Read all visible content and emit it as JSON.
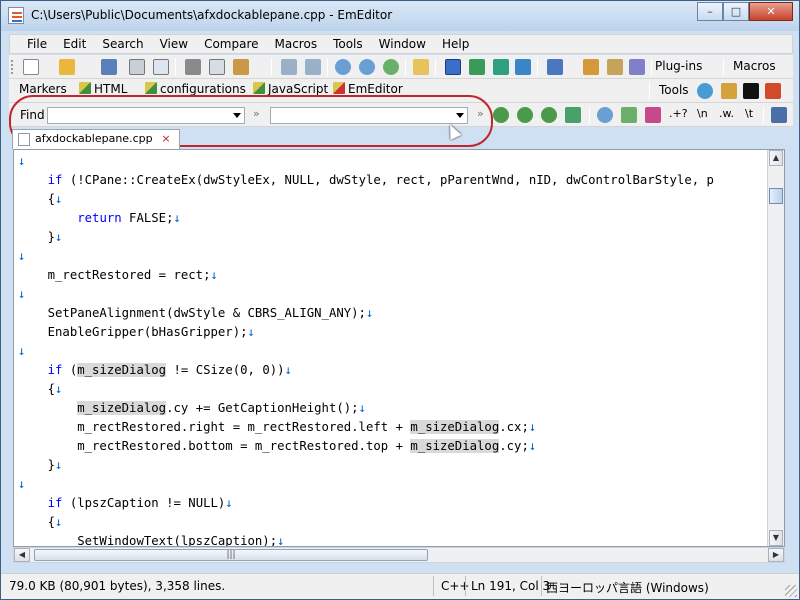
{
  "window": {
    "title": "C:\\Users\\Public\\Documents\\afxdockablepane.cpp - EmEditor",
    "minimize": "–",
    "maximize": "□",
    "close": "✕"
  },
  "menu": [
    "File",
    "Edit",
    "Search",
    "View",
    "Compare",
    "Macros",
    "Tools",
    "Window",
    "Help"
  ],
  "toolbar": {
    "plugins_label": "Plug-ins",
    "macros_label": "Macros",
    "tools_label": "Tools"
  },
  "markers": {
    "label": "Markers",
    "items": [
      "HTML",
      "configurations",
      "JavaScript",
      "EmEditor"
    ]
  },
  "find_bar": {
    "label": "Find",
    "find_value": "",
    "replace_value": "",
    "chevron": "»",
    "buttons": [
      ".+?",
      "\\n",
      ".w.",
      "\\t"
    ]
  },
  "tab": {
    "name": "afxdockablepane.cpp",
    "close": "×"
  },
  "code": {
    "lines": [
      [
        {
          "t": "↓",
          "c": "eol"
        }
      ],
      [
        {
          "t": "    "
        },
        {
          "t": "if",
          "c": "kw"
        },
        {
          "t": " (!CPane::CreateEx(dwStyleEx, NULL, dwStyle, rect, pParentWnd, nID, dwControlBarStyle, p"
        }
      ],
      [
        {
          "t": "    {"
        },
        {
          "t": "↓",
          "c": "eol"
        }
      ],
      [
        {
          "t": "        "
        },
        {
          "t": "return",
          "c": "kw"
        },
        {
          "t": " FALSE;"
        },
        {
          "t": "↓",
          "c": "eol"
        }
      ],
      [
        {
          "t": "    }"
        },
        {
          "t": "↓",
          "c": "eol"
        }
      ],
      [
        {
          "t": "↓",
          "c": "eol"
        }
      ],
      [
        {
          "t": "    m_rectRestored = rect;"
        },
        {
          "t": "↓",
          "c": "eol"
        }
      ],
      [
        {
          "t": "↓",
          "c": "eol"
        }
      ],
      [
        {
          "t": "    SetPaneAlignment(dwStyle & CBRS_ALIGN_ANY);"
        },
        {
          "t": "↓",
          "c": "eol"
        }
      ],
      [
        {
          "t": "    EnableGripper(bHasGripper);"
        },
        {
          "t": "↓",
          "c": "eol"
        }
      ],
      [
        {
          "t": "↓",
          "c": "eol"
        }
      ],
      [
        {
          "t": "    "
        },
        {
          "t": "if",
          "c": "kw"
        },
        {
          "t": " ("
        },
        {
          "t": "m_sizeDialog",
          "c": "hl"
        },
        {
          "t": " != CSize(0, 0))"
        },
        {
          "t": "↓",
          "c": "eol"
        }
      ],
      [
        {
          "t": "    {"
        },
        {
          "t": "↓",
          "c": "eol"
        }
      ],
      [
        {
          "t": "        "
        },
        {
          "t": "m_sizeDialog",
          "c": "hl"
        },
        {
          "t": ".cy += GetCaptionHeight();"
        },
        {
          "t": "↓",
          "c": "eol"
        }
      ],
      [
        {
          "t": "        m_rectRestored.right = m_rectRestored.left + "
        },
        {
          "t": "m_sizeDialog",
          "c": "hl"
        },
        {
          "t": ".cx;"
        },
        {
          "t": "↓",
          "c": "eol"
        }
      ],
      [
        {
          "t": "        m_rectRestored.bottom = m_rectRestored.top + "
        },
        {
          "t": "m_sizeDialog",
          "c": "hl"
        },
        {
          "t": ".cy;"
        },
        {
          "t": "↓",
          "c": "eol"
        }
      ],
      [
        {
          "t": "    }"
        },
        {
          "t": "↓",
          "c": "eol"
        }
      ],
      [
        {
          "t": "↓",
          "c": "eol"
        }
      ],
      [
        {
          "t": "    "
        },
        {
          "t": "if",
          "c": "kw"
        },
        {
          "t": " (lpszCaption != NULL)"
        },
        {
          "t": "↓",
          "c": "eol"
        }
      ],
      [
        {
          "t": "    {"
        },
        {
          "t": "↓",
          "c": "eol"
        }
      ],
      [
        {
          "t": "        SetWindowText(lpszCaption);"
        },
        {
          "t": "↓",
          "c": "eol"
        }
      ]
    ]
  },
  "status": {
    "size": "79.0 KB (80,901 bytes), 3,358 lines.",
    "language": "C++",
    "position": "Ln 191, Col 3",
    "encoding": "西ヨーロッパ言語 (Windows)"
  },
  "colors": {
    "keyword": "#0000ff",
    "eol_mark": "#0066cc",
    "match_highlight": "#d9d9d9",
    "highlight_oval": "#c0272d"
  }
}
